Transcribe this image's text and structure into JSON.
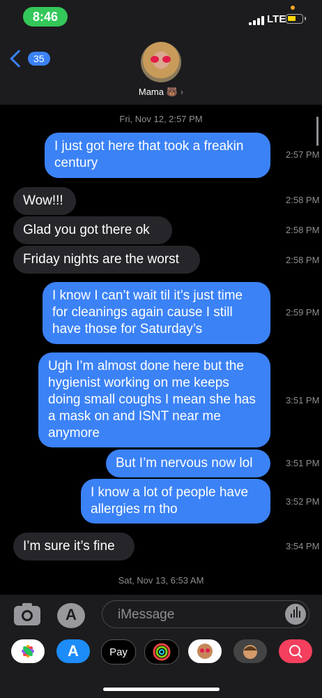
{
  "status": {
    "time": "8:46",
    "network": "LTE"
  },
  "nav": {
    "back_count": "35",
    "contact_name": "Mama 🐻",
    "arrow": "›"
  },
  "thread": {
    "date1": "Fri, Nov 12, 2:57 PM",
    "date2": "Sat, Nov 13, 6:53 AM",
    "messages": [
      {
        "from": "me",
        "text": "I just got here that took a freakin century",
        "time": "2:57 PM"
      },
      {
        "from": "them",
        "text": "Wow!!!",
        "time": "2:58 PM"
      },
      {
        "from": "them",
        "text": "Glad you got there ok",
        "time": "2:58 PM"
      },
      {
        "from": "them",
        "text": "Friday nights are the worst",
        "time": "2:58 PM"
      },
      {
        "from": "me",
        "text": "I know I can’t wait til it’s just time for cleanings again cause I still have those for Saturday’s",
        "time": "2:59 PM"
      },
      {
        "from": "me",
        "text": "Ugh I’m almost done here but the hygienist working on me keeps doing small coughs I mean she has a mask on and ISNT near me anymore",
        "time": "3:51 PM"
      },
      {
        "from": "me",
        "text": "But I’m nervous now lol",
        "time": "3:51 PM"
      },
      {
        "from": "me",
        "text": "I know a lot of people have allergies rn tho",
        "time": "3:52 PM"
      },
      {
        "from": "them",
        "text": "I’m sure it’s fine",
        "time": "3:54 PM"
      }
    ]
  },
  "composer": {
    "placeholder": "iMessage"
  },
  "tray": {
    "apple_pay_label": "Pay"
  },
  "colors": {
    "outgoing": "#3b82f6",
    "incoming": "#26262a",
    "status_green": "#34c759"
  },
  "icons": [
    "camera-icon",
    "app-store-icon",
    "mic-waveform-icon",
    "photos-icon",
    "apple-pay-icon",
    "activity-icon",
    "memoji-icon",
    "search-web-icon"
  ]
}
